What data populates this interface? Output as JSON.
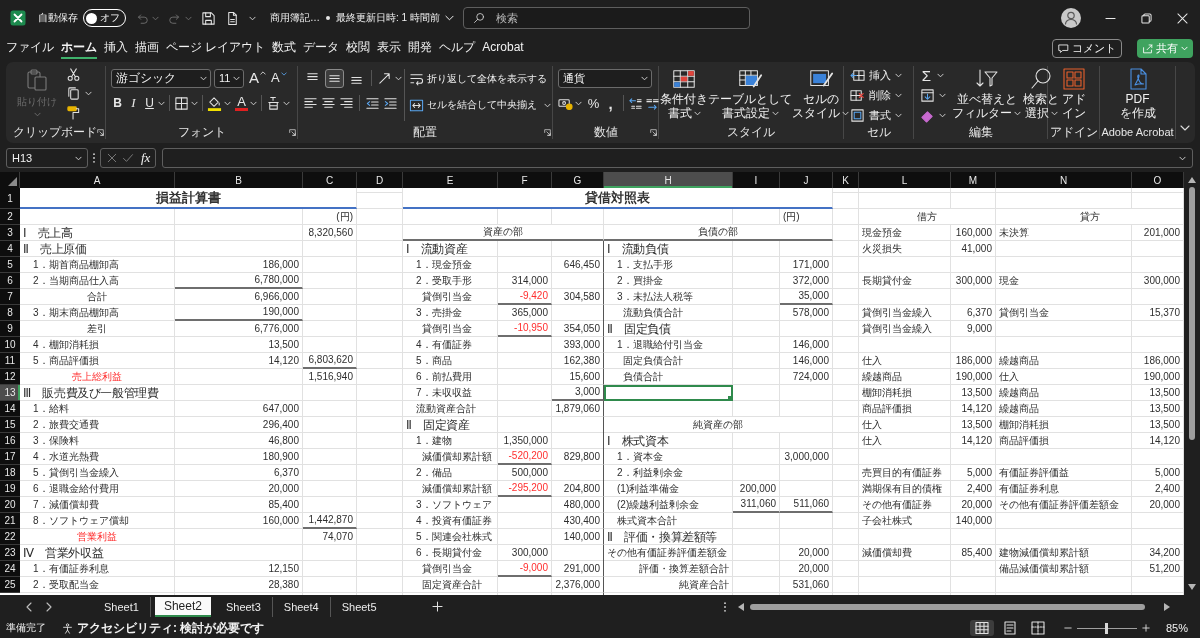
{
  "title_bar": {
    "autosave_label": "自動保存",
    "autosave": {
      "label": "オフ",
      "on": false
    },
    "undo": {
      "disabled": true
    },
    "redo": {
      "disabled": true
    },
    "document_title": "商用簿記…",
    "save_status": "最終更新日時: 1 時間前",
    "search": {
      "placeholder": "検索"
    }
  },
  "menu_tabs": [
    {
      "label": "ファイル",
      "selected": false
    },
    {
      "label": "ホーム",
      "selected": true
    },
    {
      "label": "挿入",
      "selected": false
    },
    {
      "label": "描画",
      "selected": false
    },
    {
      "label": "ページ レイアウト",
      "selected": false
    },
    {
      "label": "数式",
      "selected": false
    },
    {
      "label": "データ",
      "selected": false
    },
    {
      "label": "校閲",
      "selected": false
    },
    {
      "label": "表示",
      "selected": false
    },
    {
      "label": "開発",
      "selected": false
    },
    {
      "label": "ヘルプ",
      "selected": false
    },
    {
      "label": "Acrobat",
      "selected": false
    }
  ],
  "comment_button": "コメント",
  "share_button": "共有",
  "ribbon": {
    "groups": [
      {
        "kind": "clipboard",
        "label": "クリップボード",
        "paste": {
          "label": "貼り付け",
          "disabled": true
        }
      },
      {
        "kind": "font",
        "label": "フォント",
        "font_name": "游ゴシック",
        "font_size": "11",
        "grow": "A",
        "shrink": "A",
        "bold": "B",
        "italic": "I",
        "underline": "U",
        "font_color": "A"
      },
      {
        "kind": "alignment",
        "label": "配置",
        "vertical_align": [
          {
            "kind": "top",
            "selected": false
          },
          {
            "kind": "middle",
            "selected": true
          },
          {
            "kind": "bottom",
            "selected": false
          }
        ],
        "wrap": "折り返して全体を表示する",
        "merge": "セルを結合して中央揃え"
      },
      {
        "kind": "number",
        "label": "数値",
        "format": "通貨",
        "percent": "%",
        "comma": ","
      },
      {
        "kind": "styles",
        "label": "スタイル",
        "buttons": [
          {
            "kind": "conditional",
            "lines": [
              "条件付き",
              "書式"
            ]
          },
          {
            "kind": "table",
            "lines": [
              "テーブルとして",
              "書式設定"
            ]
          },
          {
            "kind": "cell_styles",
            "lines": [
              "セルの",
              "スタイル"
            ]
          }
        ]
      },
      {
        "kind": "cells",
        "label": "セル",
        "buttons": [
          {
            "kind": "insert",
            "label": "挿入"
          },
          {
            "kind": "delete",
            "label": "削除"
          },
          {
            "kind": "format",
            "label": "書式"
          }
        ]
      },
      {
        "kind": "editing",
        "label": "編集",
        "sum": "Σ",
        "buttons": [
          {
            "kind": "sort",
            "lines": [
              "並べ替えと",
              "フィルター"
            ]
          },
          {
            "kind": "find",
            "lines": [
              "検索と",
              "選択"
            ]
          }
        ]
      },
      {
        "kind": "addins",
        "label": "アドイン",
        "button": {
          "lines": [
            "アド",
            "イン"
          ]
        }
      },
      {
        "kind": "acrobat",
        "label": "Adobe Acrobat",
        "button": {
          "lines": [
            "PDF",
            "を作成"
          ]
        }
      }
    ]
  },
  "formula_bar": {
    "name_box": "H13",
    "function_label": "fx"
  },
  "sheet": {
    "columns": [
      {
        "label": "A",
        "selected": false
      },
      {
        "label": "B",
        "selected": false
      },
      {
        "label": "C",
        "selected": false
      },
      {
        "label": "D",
        "selected": false
      },
      {
        "label": "E",
        "selected": false
      },
      {
        "label": "F",
        "selected": false
      },
      {
        "label": "G",
        "selected": false
      },
      {
        "label": "H",
        "selected": true
      },
      {
        "label": "I",
        "selected": false
      },
      {
        "label": "J",
        "selected": false
      },
      {
        "label": "K",
        "selected": false
      },
      {
        "label": "L",
        "selected": false
      },
      {
        "label": "M",
        "selected": false
      },
      {
        "label": "N",
        "selected": false
      },
      {
        "label": "O",
        "selected": false
      }
    ],
    "rows": [
      {
        "number": "1",
        "selected": false,
        "cells": [
          {
            "text": "損益計算書",
            "kind": "title"
          },
          {
            "kind": "merged"
          },
          {
            "kind": "merged"
          },
          null,
          {
            "text": "貸借対照表",
            "kind": "title"
          },
          {
            "kind": "merged"
          },
          {
            "kind": "merged"
          },
          {
            "kind": "merged"
          },
          {
            "kind": "merged"
          },
          {
            "kind": "merged"
          },
          null,
          null,
          null,
          null,
          null
        ]
      },
      {
        "number": "2",
        "selected": false,
        "cells": [
          null,
          null,
          {
            "text": "(円)",
            "kind": "amount"
          },
          null,
          null,
          null,
          null,
          null,
          null,
          {
            "text": "(円)",
            "kind": "text"
          },
          null,
          {
            "text": "借方",
            "kind": "heading"
          },
          {
            "kind": "merged"
          },
          {
            "text": "貸方",
            "kind": "heading"
          },
          {
            "kind": "merged"
          }
        ]
      },
      {
        "number": "3",
        "selected": false,
        "cells": [
          {
            "text": "Ⅰ　売上高",
            "kind": "section"
          },
          null,
          {
            "text": "8,320,560",
            "kind": "amount"
          },
          null,
          {
            "text": "資産の部",
            "kind": "heading",
            "rule": true
          },
          {
            "kind": "merged"
          },
          {
            "kind": "merged"
          },
          {
            "text": "負債の部",
            "kind": "heading",
            "rule": true
          },
          {
            "kind": "merged"
          },
          {
            "kind": "merged"
          },
          null,
          {
            "text": "現金預金",
            "kind": "text"
          },
          {
            "text": "160,000",
            "kind": "amount"
          },
          {
            "text": "未決算",
            "kind": "text"
          },
          {
            "text": "201,000",
            "kind": "amount"
          }
        ]
      },
      {
        "number": "4",
        "selected": false,
        "cells": [
          {
            "text": "Ⅱ　売上原価",
            "kind": "section"
          },
          null,
          null,
          null,
          {
            "text": "Ⅰ　流動資産",
            "kind": "section"
          },
          null,
          null,
          {
            "text": "Ⅰ　流動負債",
            "kind": "section"
          },
          null,
          null,
          null,
          {
            "text": "火災損失",
            "kind": "text"
          },
          {
            "text": "41,000",
            "kind": "amount"
          },
          null,
          null
        ]
      },
      {
        "number": "5",
        "selected": false,
        "cells": [
          {
            "text": "1．期首商品棚卸高",
            "kind": "item"
          },
          {
            "text": "186,000",
            "kind": "amount"
          },
          null,
          null,
          {
            "text": "1．現金預金",
            "kind": "item"
          },
          null,
          {
            "text": "646,450",
            "kind": "amount"
          },
          {
            "text": "1．支払手形",
            "kind": "item"
          },
          null,
          {
            "text": "171,000",
            "kind": "amount"
          },
          null,
          null,
          null,
          null,
          null
        ]
      },
      {
        "number": "6",
        "selected": false,
        "cells": [
          {
            "text": "2．当期商品仕入高",
            "kind": "item"
          },
          {
            "text": "6,780,000",
            "kind": "amount",
            "rule": true
          },
          null,
          null,
          {
            "text": "2．受取手形",
            "kind": "item"
          },
          {
            "text": "314,000",
            "kind": "amount"
          },
          null,
          {
            "text": "2．買掛金",
            "kind": "item"
          },
          null,
          {
            "text": "372,000",
            "kind": "amount"
          },
          null,
          {
            "text": "長期貸付金",
            "kind": "text"
          },
          {
            "text": "300,000",
            "kind": "amount"
          },
          {
            "text": "現金",
            "kind": "text"
          },
          {
            "text": "300,000",
            "kind": "amount"
          }
        ]
      },
      {
        "number": "7",
        "selected": false,
        "cells": [
          {
            "text": "合計",
            "kind": "heading"
          },
          {
            "text": "6,966,000",
            "kind": "amount"
          },
          null,
          null,
          {
            "text": "貸倒引当金",
            "kind": "sub"
          },
          {
            "text": "-9,420",
            "kind": "negative",
            "rule": true
          },
          {
            "text": "304,580",
            "kind": "amount"
          },
          {
            "text": "3．未払法人税等",
            "kind": "item"
          },
          null,
          {
            "text": "35,000",
            "kind": "amount",
            "rule": true
          },
          null,
          null,
          null,
          null,
          null
        ]
      },
      {
        "number": "8",
        "selected": false,
        "cells": [
          {
            "text": "3．期末商品棚卸高",
            "kind": "item"
          },
          {
            "text": "190,000",
            "kind": "amount",
            "rule": true
          },
          null,
          null,
          {
            "text": "3．売掛金",
            "kind": "item"
          },
          {
            "text": "365,000",
            "kind": "amount"
          },
          null,
          {
            "text": "流動負債合計",
            "kind": "sub"
          },
          null,
          {
            "text": "578,000",
            "kind": "amount"
          },
          null,
          {
            "text": "貸倒引当金繰入",
            "kind": "text"
          },
          {
            "text": "6,370",
            "kind": "amount"
          },
          {
            "text": "貸倒引当金",
            "kind": "text"
          },
          {
            "text": "15,370",
            "kind": "amount"
          }
        ]
      },
      {
        "number": "9",
        "selected": false,
        "cells": [
          {
            "text": "差引",
            "kind": "heading"
          },
          {
            "text": "6,776,000",
            "kind": "amount"
          },
          null,
          null,
          {
            "text": "貸倒引当金",
            "kind": "sub"
          },
          {
            "text": "-10,950",
            "kind": "negative",
            "rule": true
          },
          {
            "text": "354,050",
            "kind": "amount"
          },
          {
            "text": "Ⅱ　固定負債",
            "kind": "section"
          },
          null,
          null,
          null,
          {
            "text": "貸倒引当金繰入",
            "kind": "text"
          },
          {
            "text": "9,000",
            "kind": "amount"
          },
          null,
          null
        ]
      },
      {
        "number": "10",
        "selected": false,
        "cells": [
          {
            "text": "4．棚卸消耗損",
            "kind": "item"
          },
          {
            "text": "13,500",
            "kind": "amount"
          },
          null,
          null,
          {
            "text": "4．有価証券",
            "kind": "item"
          },
          null,
          {
            "text": "393,000",
            "kind": "amount"
          },
          {
            "text": "1．退職給付引当金",
            "kind": "item"
          },
          null,
          {
            "text": "146,000",
            "kind": "amount"
          },
          null,
          null,
          null,
          null,
          null
        ]
      },
      {
        "number": "11",
        "selected": false,
        "cells": [
          {
            "text": "5．商品評価損",
            "kind": "item"
          },
          {
            "text": "14,120",
            "kind": "amount"
          },
          {
            "text": "6,803,620",
            "kind": "amount",
            "rule": true
          },
          null,
          {
            "text": "5．商品",
            "kind": "item"
          },
          null,
          {
            "text": "162,380",
            "kind": "amount"
          },
          {
            "text": "固定負債合計",
            "kind": "sub"
          },
          null,
          {
            "text": "146,000",
            "kind": "amount"
          },
          null,
          {
            "text": "仕入",
            "kind": "text"
          },
          {
            "text": "186,000",
            "kind": "amount"
          },
          {
            "text": "繰越商品",
            "kind": "text"
          },
          {
            "text": "186,000",
            "kind": "amount"
          }
        ]
      },
      {
        "number": "12",
        "selected": false,
        "cells": [
          {
            "text": "売上総利益",
            "kind": "profit"
          },
          null,
          {
            "text": "1,516,940",
            "kind": "amount"
          },
          null,
          {
            "text": "6．前払費用",
            "kind": "item"
          },
          null,
          {
            "text": "15,600",
            "kind": "amount"
          },
          {
            "text": "負債合計",
            "kind": "sub"
          },
          null,
          {
            "text": "724,000",
            "kind": "amount"
          },
          null,
          {
            "text": "繰越商品",
            "kind": "text"
          },
          {
            "text": "190,000",
            "kind": "amount"
          },
          {
            "text": "仕入",
            "kind": "text"
          },
          {
            "text": "190,000",
            "kind": "amount"
          }
        ]
      },
      {
        "number": "13",
        "selected": true,
        "cells": [
          {
            "text": "Ⅲ　販売費及び一般管理費",
            "kind": "section"
          },
          null,
          null,
          null,
          {
            "text": "7．未収収益",
            "kind": "item"
          },
          null,
          {
            "text": "3,000",
            "kind": "amount",
            "rule": true
          },
          null,
          null,
          null,
          null,
          {
            "text": "棚卸消耗損",
            "kind": "text"
          },
          {
            "text": "13,500",
            "kind": "amount"
          },
          {
            "text": "繰越商品",
            "kind": "text"
          },
          {
            "text": "13,500",
            "kind": "amount"
          }
        ]
      },
      {
        "number": "14",
        "selected": false,
        "cells": [
          {
            "text": "1．給料",
            "kind": "item"
          },
          {
            "text": "647,000",
            "kind": "amount"
          },
          null,
          null,
          {
            "text": "流動資産合計",
            "kind": "item"
          },
          null,
          {
            "text": "1,879,060",
            "kind": "amount"
          },
          null,
          null,
          null,
          null,
          {
            "text": "商品評価損",
            "kind": "text"
          },
          {
            "text": "14,120",
            "kind": "amount"
          },
          {
            "text": "繰越商品",
            "kind": "text"
          },
          {
            "text": "13,500",
            "kind": "amount"
          }
        ]
      },
      {
        "number": "15",
        "selected": false,
        "cells": [
          {
            "text": "2．旅費交通費",
            "kind": "item"
          },
          {
            "text": "296,400",
            "kind": "amount"
          },
          null,
          null,
          {
            "text": "Ⅱ　固定資産",
            "kind": "section"
          },
          null,
          null,
          {
            "text": "純資産の部",
            "kind": "heading"
          },
          {
            "kind": "merged"
          },
          {
            "kind": "merged"
          },
          null,
          {
            "text": "仕入",
            "kind": "text"
          },
          {
            "text": "13,500",
            "kind": "amount"
          },
          {
            "text": "棚卸消耗損",
            "kind": "text"
          },
          {
            "text": "13,500",
            "kind": "amount"
          }
        ]
      },
      {
        "number": "16",
        "selected": false,
        "cells": [
          {
            "text": "3．保険料",
            "kind": "item"
          },
          {
            "text": "46,800",
            "kind": "amount"
          },
          null,
          null,
          {
            "text": "1．建物",
            "kind": "item"
          },
          {
            "text": "1,350,000",
            "kind": "amount"
          },
          null,
          {
            "text": "Ⅰ　株式資本",
            "kind": "section"
          },
          null,
          null,
          null,
          {
            "text": "仕入",
            "kind": "text"
          },
          {
            "text": "14,120",
            "kind": "amount"
          },
          {
            "text": "商品評価損",
            "kind": "text"
          },
          {
            "text": "14,120",
            "kind": "amount"
          }
        ]
      },
      {
        "number": "17",
        "selected": false,
        "cells": [
          {
            "text": "4．水道光熱費",
            "kind": "item"
          },
          {
            "text": "180,900",
            "kind": "amount"
          },
          null,
          null,
          {
            "text": "減価償却累計額",
            "kind": "sub"
          },
          {
            "text": "-520,200",
            "kind": "negative",
            "rule": true
          },
          {
            "text": "829,800",
            "kind": "amount"
          },
          {
            "text": "1．資本金",
            "kind": "item"
          },
          null,
          {
            "text": "3,000,000",
            "kind": "amount"
          },
          null,
          null,
          null,
          null,
          null
        ]
      },
      {
        "number": "18",
        "selected": false,
        "cells": [
          {
            "text": "5．貸倒引当金繰入",
            "kind": "item"
          },
          {
            "text": "6,370",
            "kind": "amount"
          },
          null,
          null,
          {
            "text": "2．備品",
            "kind": "item"
          },
          {
            "text": "500,000",
            "kind": "amount"
          },
          null,
          {
            "text": "2．利益剰余金",
            "kind": "item"
          },
          null,
          null,
          null,
          {
            "text": "売買目的有価証券",
            "kind": "text"
          },
          {
            "text": "5,000",
            "kind": "amount"
          },
          {
            "text": "有価証券評価益",
            "kind": "text"
          },
          {
            "text": "5,000",
            "kind": "amount"
          }
        ]
      },
      {
        "number": "19",
        "selected": false,
        "cells": [
          {
            "text": "6．退職金給付費用",
            "kind": "item"
          },
          {
            "text": "20,000",
            "kind": "amount"
          },
          null,
          null,
          {
            "text": "減価償却累計額",
            "kind": "sub"
          },
          {
            "text": "-295,200",
            "kind": "negative",
            "rule": true
          },
          {
            "text": "204,800",
            "kind": "amount"
          },
          {
            "text": "(1)利益準備金",
            "kind": "item"
          },
          {
            "text": "200,000",
            "kind": "amount"
          },
          null,
          null,
          {
            "text": "満期保有目的債権",
            "kind": "text"
          },
          {
            "text": "2,400",
            "kind": "amount"
          },
          {
            "text": "有価証券利息",
            "kind": "text"
          },
          {
            "text": "2,400",
            "kind": "amount"
          }
        ]
      },
      {
        "number": "20",
        "selected": false,
        "cells": [
          {
            "text": "7．減価償却費",
            "kind": "item"
          },
          {
            "text": "85,400",
            "kind": "amount"
          },
          null,
          null,
          {
            "text": "3．ソフトウェア",
            "kind": "item"
          },
          null,
          {
            "text": "480,000",
            "kind": "amount"
          },
          {
            "text": "(2)繰越利益剰余金",
            "kind": "item"
          },
          {
            "text": "311,060",
            "kind": "amount",
            "rule": true
          },
          {
            "text": "511,060",
            "kind": "amount",
            "rule": true
          },
          null,
          {
            "text": "その他有価証券",
            "kind": "text"
          },
          {
            "text": "20,000",
            "kind": "amount"
          },
          {
            "text": "その他有価証券評価差額金",
            "kind": "text"
          },
          {
            "text": "20,000",
            "kind": "amount"
          }
        ]
      },
      {
        "number": "21",
        "selected": false,
        "cells": [
          {
            "text": "8．ソフトウェア償却",
            "kind": "item"
          },
          {
            "text": "160,000",
            "kind": "amount"
          },
          {
            "text": "1,442,870",
            "kind": "amount",
            "rule": true
          },
          null,
          {
            "text": "4．投資有価証券",
            "kind": "item"
          },
          null,
          {
            "text": "430,400",
            "kind": "amount"
          },
          {
            "text": "株式資本合計",
            "kind": "item"
          },
          null,
          null,
          null,
          {
            "text": "子会社株式",
            "kind": "text"
          },
          {
            "text": "140,000",
            "kind": "amount"
          },
          null,
          null
        ]
      },
      {
        "number": "22",
        "selected": false,
        "cells": [
          {
            "text": "営業利益",
            "kind": "profit"
          },
          null,
          {
            "text": "74,070",
            "kind": "amount"
          },
          null,
          {
            "text": "5．関連会社株式",
            "kind": "item"
          },
          null,
          {
            "text": "140,000",
            "kind": "amount"
          },
          {
            "text": "Ⅱ　評価・換算差額等",
            "kind": "section"
          },
          null,
          null,
          null,
          null,
          null,
          null,
          null
        ]
      },
      {
        "number": "23",
        "selected": false,
        "cells": [
          {
            "text": "Ⅳ　営業外収益",
            "kind": "section"
          },
          null,
          null,
          null,
          {
            "text": "6．長期貸付金",
            "kind": "item"
          },
          {
            "text": "300,000",
            "kind": "amount"
          },
          null,
          {
            "text": "その他有価証券評価差額金",
            "kind": "text"
          },
          null,
          {
            "text": "20,000",
            "kind": "amount"
          },
          null,
          {
            "text": "減価償却費",
            "kind": "text"
          },
          {
            "text": "85,400",
            "kind": "amount"
          },
          {
            "text": "建物減価償却累計額",
            "kind": "text"
          },
          {
            "text": "34,200",
            "kind": "amount"
          }
        ]
      },
      {
        "number": "24",
        "selected": false,
        "cells": [
          {
            "text": "1．有価証券利息",
            "kind": "item"
          },
          {
            "text": "12,150",
            "kind": "amount"
          },
          null,
          null,
          {
            "text": "貸倒引当金",
            "kind": "sub"
          },
          {
            "text": "-9,000",
            "kind": "negative",
            "rule": true
          },
          {
            "text": "291,000",
            "kind": "amount"
          },
          {
            "text": "評価・換算差額合計",
            "kind": "caption"
          },
          null,
          {
            "text": "20,000",
            "kind": "amount"
          },
          null,
          null,
          null,
          {
            "text": "備品減価償却累計額",
            "kind": "text"
          },
          {
            "text": "51,200",
            "kind": "amount"
          }
        ]
      },
      {
        "number": "25",
        "selected": false,
        "cells": [
          {
            "text": "2．受取配当金",
            "kind": "item"
          },
          {
            "text": "28,380",
            "kind": "amount"
          },
          null,
          null,
          {
            "text": "固定資産合計",
            "kind": "sub"
          },
          null,
          {
            "text": "2,376,000",
            "kind": "amount"
          },
          {
            "text": "純資産合計",
            "kind": "caption"
          },
          null,
          {
            "text": "531,060",
            "kind": "amount"
          },
          null,
          null,
          null,
          null,
          null
        ]
      }
    ]
  },
  "sheet_tabs": [
    {
      "label": "Sheet1",
      "selected": false
    },
    {
      "label": "Sheet2",
      "selected": true
    },
    {
      "label": "Sheet3",
      "selected": false
    },
    {
      "label": "Sheet4",
      "selected": false
    },
    {
      "label": "Sheet5",
      "selected": false
    }
  ],
  "status_bar": {
    "ready": "準備完了",
    "accessibility": "アクセシビリティ: 検討が必要です",
    "views": [
      {
        "kind": "normal",
        "selected": true
      },
      {
        "kind": "page_layout",
        "selected": false
      },
      {
        "kind": "page_break",
        "selected": false
      }
    ],
    "zoom": {
      "level": 0.48,
      "reading": "85%"
    }
  }
}
